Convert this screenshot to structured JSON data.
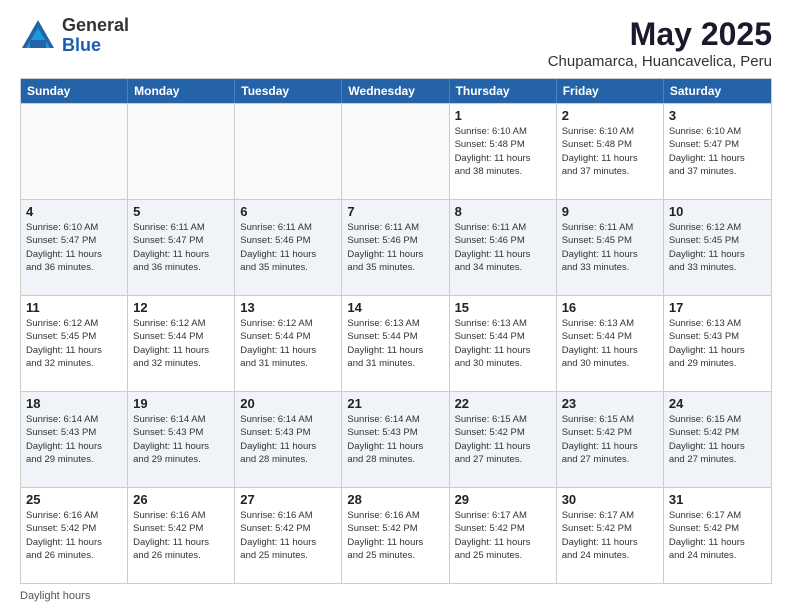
{
  "logo": {
    "general": "General",
    "blue": "Blue"
  },
  "title": {
    "month": "May 2025",
    "location": "Chupamarca, Huancavelica, Peru"
  },
  "header_days": [
    "Sunday",
    "Monday",
    "Tuesday",
    "Wednesday",
    "Thursday",
    "Friday",
    "Saturday"
  ],
  "weeks": [
    [
      {
        "day": "",
        "info": "",
        "empty": true
      },
      {
        "day": "",
        "info": "",
        "empty": true
      },
      {
        "day": "",
        "info": "",
        "empty": true
      },
      {
        "day": "",
        "info": "",
        "empty": true
      },
      {
        "day": "1",
        "info": "Sunrise: 6:10 AM\nSunset: 5:48 PM\nDaylight: 11 hours\nand 38 minutes.",
        "empty": false
      },
      {
        "day": "2",
        "info": "Sunrise: 6:10 AM\nSunset: 5:48 PM\nDaylight: 11 hours\nand 37 minutes.",
        "empty": false
      },
      {
        "day": "3",
        "info": "Sunrise: 6:10 AM\nSunset: 5:47 PM\nDaylight: 11 hours\nand 37 minutes.",
        "empty": false
      }
    ],
    [
      {
        "day": "4",
        "info": "Sunrise: 6:10 AM\nSunset: 5:47 PM\nDaylight: 11 hours\nand 36 minutes.",
        "empty": false
      },
      {
        "day": "5",
        "info": "Sunrise: 6:11 AM\nSunset: 5:47 PM\nDaylight: 11 hours\nand 36 minutes.",
        "empty": false
      },
      {
        "day": "6",
        "info": "Sunrise: 6:11 AM\nSunset: 5:46 PM\nDaylight: 11 hours\nand 35 minutes.",
        "empty": false
      },
      {
        "day": "7",
        "info": "Sunrise: 6:11 AM\nSunset: 5:46 PM\nDaylight: 11 hours\nand 35 minutes.",
        "empty": false
      },
      {
        "day": "8",
        "info": "Sunrise: 6:11 AM\nSunset: 5:46 PM\nDaylight: 11 hours\nand 34 minutes.",
        "empty": false
      },
      {
        "day": "9",
        "info": "Sunrise: 6:11 AM\nSunset: 5:45 PM\nDaylight: 11 hours\nand 33 minutes.",
        "empty": false
      },
      {
        "day": "10",
        "info": "Sunrise: 6:12 AM\nSunset: 5:45 PM\nDaylight: 11 hours\nand 33 minutes.",
        "empty": false
      }
    ],
    [
      {
        "day": "11",
        "info": "Sunrise: 6:12 AM\nSunset: 5:45 PM\nDaylight: 11 hours\nand 32 minutes.",
        "empty": false
      },
      {
        "day": "12",
        "info": "Sunrise: 6:12 AM\nSunset: 5:44 PM\nDaylight: 11 hours\nand 32 minutes.",
        "empty": false
      },
      {
        "day": "13",
        "info": "Sunrise: 6:12 AM\nSunset: 5:44 PM\nDaylight: 11 hours\nand 31 minutes.",
        "empty": false
      },
      {
        "day": "14",
        "info": "Sunrise: 6:13 AM\nSunset: 5:44 PM\nDaylight: 11 hours\nand 31 minutes.",
        "empty": false
      },
      {
        "day": "15",
        "info": "Sunrise: 6:13 AM\nSunset: 5:44 PM\nDaylight: 11 hours\nand 30 minutes.",
        "empty": false
      },
      {
        "day": "16",
        "info": "Sunrise: 6:13 AM\nSunset: 5:44 PM\nDaylight: 11 hours\nand 30 minutes.",
        "empty": false
      },
      {
        "day": "17",
        "info": "Sunrise: 6:13 AM\nSunset: 5:43 PM\nDaylight: 11 hours\nand 29 minutes.",
        "empty": false
      }
    ],
    [
      {
        "day": "18",
        "info": "Sunrise: 6:14 AM\nSunset: 5:43 PM\nDaylight: 11 hours\nand 29 minutes.",
        "empty": false
      },
      {
        "day": "19",
        "info": "Sunrise: 6:14 AM\nSunset: 5:43 PM\nDaylight: 11 hours\nand 29 minutes.",
        "empty": false
      },
      {
        "day": "20",
        "info": "Sunrise: 6:14 AM\nSunset: 5:43 PM\nDaylight: 11 hours\nand 28 minutes.",
        "empty": false
      },
      {
        "day": "21",
        "info": "Sunrise: 6:14 AM\nSunset: 5:43 PM\nDaylight: 11 hours\nand 28 minutes.",
        "empty": false
      },
      {
        "day": "22",
        "info": "Sunrise: 6:15 AM\nSunset: 5:42 PM\nDaylight: 11 hours\nand 27 minutes.",
        "empty": false
      },
      {
        "day": "23",
        "info": "Sunrise: 6:15 AM\nSunset: 5:42 PM\nDaylight: 11 hours\nand 27 minutes.",
        "empty": false
      },
      {
        "day": "24",
        "info": "Sunrise: 6:15 AM\nSunset: 5:42 PM\nDaylight: 11 hours\nand 27 minutes.",
        "empty": false
      }
    ],
    [
      {
        "day": "25",
        "info": "Sunrise: 6:16 AM\nSunset: 5:42 PM\nDaylight: 11 hours\nand 26 minutes.",
        "empty": false
      },
      {
        "day": "26",
        "info": "Sunrise: 6:16 AM\nSunset: 5:42 PM\nDaylight: 11 hours\nand 26 minutes.",
        "empty": false
      },
      {
        "day": "27",
        "info": "Sunrise: 6:16 AM\nSunset: 5:42 PM\nDaylight: 11 hours\nand 25 minutes.",
        "empty": false
      },
      {
        "day": "28",
        "info": "Sunrise: 6:16 AM\nSunset: 5:42 PM\nDaylight: 11 hours\nand 25 minutes.",
        "empty": false
      },
      {
        "day": "29",
        "info": "Sunrise: 6:17 AM\nSunset: 5:42 PM\nDaylight: 11 hours\nand 25 minutes.",
        "empty": false
      },
      {
        "day": "30",
        "info": "Sunrise: 6:17 AM\nSunset: 5:42 PM\nDaylight: 11 hours\nand 24 minutes.",
        "empty": false
      },
      {
        "day": "31",
        "info": "Sunrise: 6:17 AM\nSunset: 5:42 PM\nDaylight: 11 hours\nand 24 minutes.",
        "empty": false
      }
    ]
  ],
  "footer": {
    "daylight_label": "Daylight hours"
  }
}
